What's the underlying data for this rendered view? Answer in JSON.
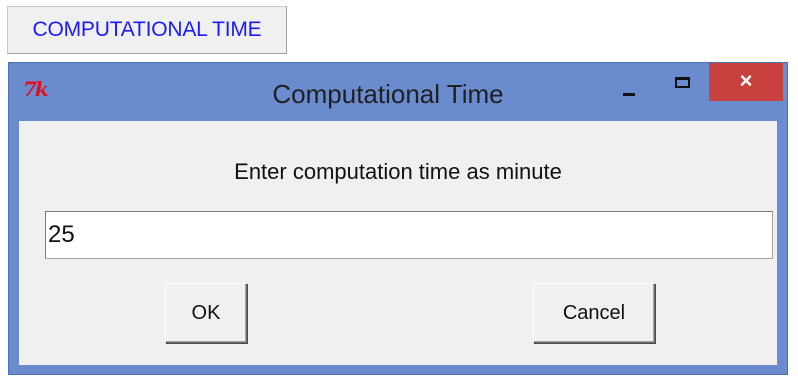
{
  "launcher": {
    "label": "COMPUTATIONAL TIME",
    "color": "#1a1aff"
  },
  "dialog": {
    "title": "Computational Time",
    "app_icon": "tk-feather-icon",
    "app_icon_text": "7k",
    "titlebar_color": "#6a8ccf",
    "close_color": "#c7413e",
    "controls": {
      "minimize": "minimize-icon",
      "maximize": "maximize-icon",
      "close": "×"
    },
    "prompt": "Enter computation time as minute",
    "input_value": "25",
    "ok_label": "OK",
    "cancel_label": "Cancel"
  }
}
